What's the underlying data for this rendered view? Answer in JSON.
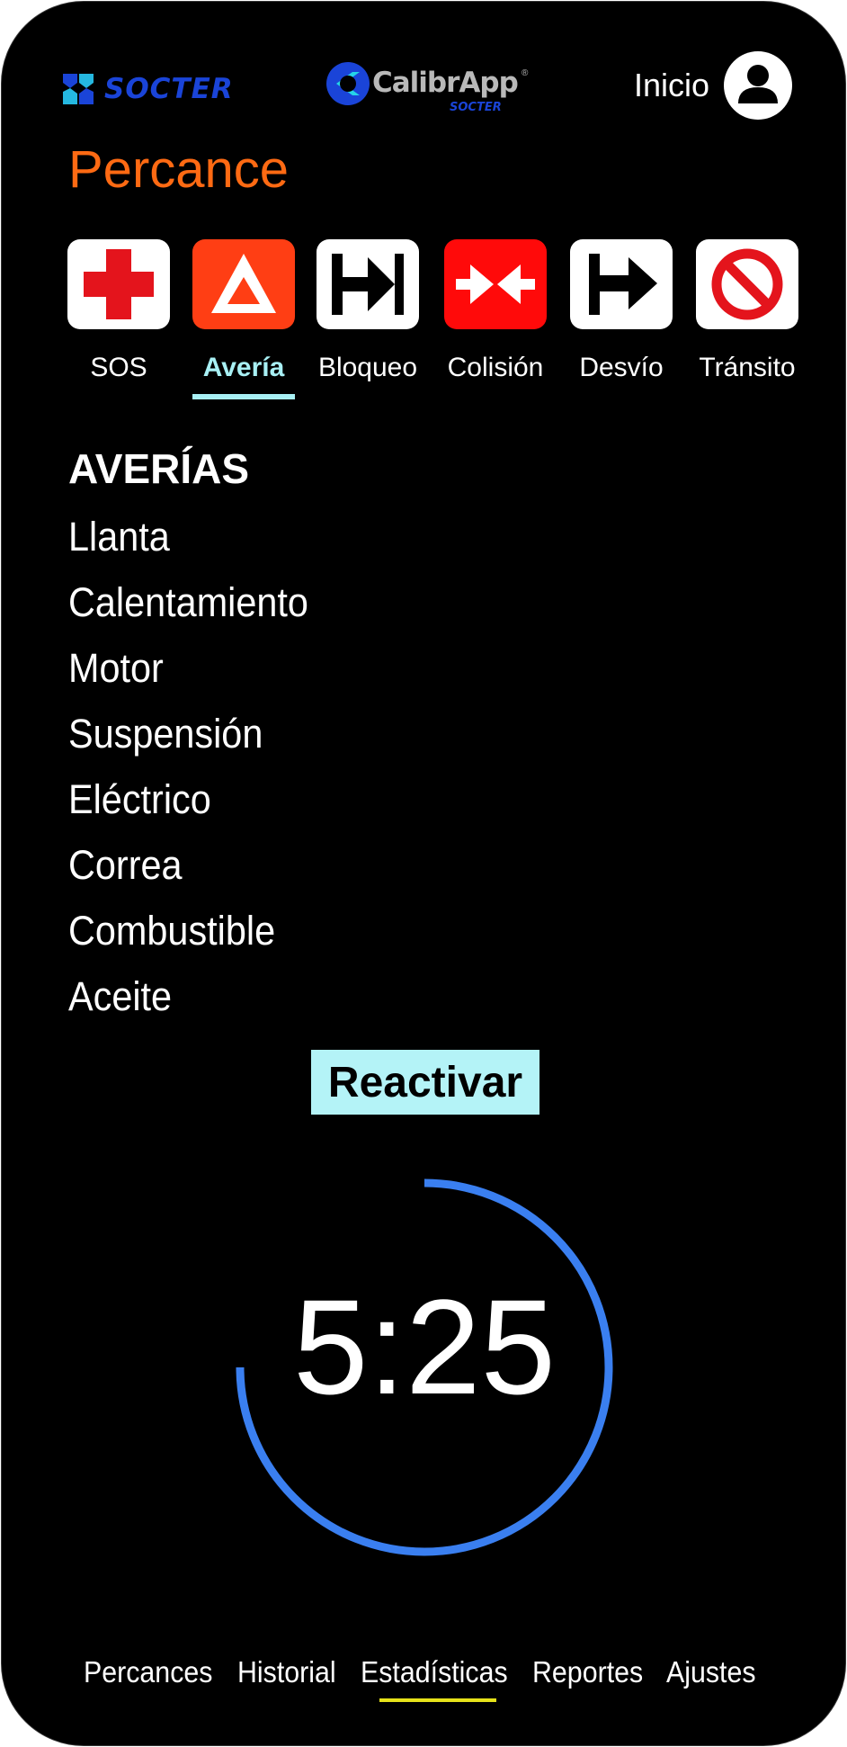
{
  "colors": {
    "background": "#000000",
    "title": "#ff6a13",
    "accent_active": "#a8f0f4",
    "button_bg": "#b4f3f7",
    "timer_ring": "#3a7ff0",
    "nav_underline": "#e6e21a",
    "brand_blue": "#1a44d8"
  },
  "header": {
    "brand_left": "SOCTER",
    "app_logo": {
      "name_part1": "Calibr",
      "name_part2": "App",
      "registered": "®",
      "subtitle": "SOCTER"
    },
    "home_label": "Inicio",
    "avatar_icon": "user-avatar-icon"
  },
  "page": {
    "title": "Percance"
  },
  "categories": [
    {
      "label": "SOS",
      "icon": "red-cross-icon",
      "active": false
    },
    {
      "label": "Avería",
      "icon": "warning-triangle-icon",
      "active": true
    },
    {
      "label": "Bloqueo",
      "icon": "block-arrow-icon",
      "active": false
    },
    {
      "label": "Colisión",
      "icon": "collision-icon",
      "active": false
    },
    {
      "label": "Desvío",
      "icon": "detour-arrow-icon",
      "active": false
    },
    {
      "label": "Tránsito",
      "icon": "no-entry-icon",
      "active": false
    }
  ],
  "list": {
    "heading": "AVERÍAS",
    "items": [
      "Llanta",
      "Calentamiento",
      "Motor",
      "Suspensión",
      "Eléctrico",
      "Correa",
      "Combustible",
      "Aceite"
    ]
  },
  "action": {
    "reactivate_label": "Reactivar"
  },
  "timer": {
    "display": "5:25",
    "ring_progress": 0.75
  },
  "bottom_nav": {
    "items": [
      "Percances",
      "Historial",
      "Estadísticas",
      "Reportes",
      "Ajustes"
    ],
    "active_index": 2
  }
}
